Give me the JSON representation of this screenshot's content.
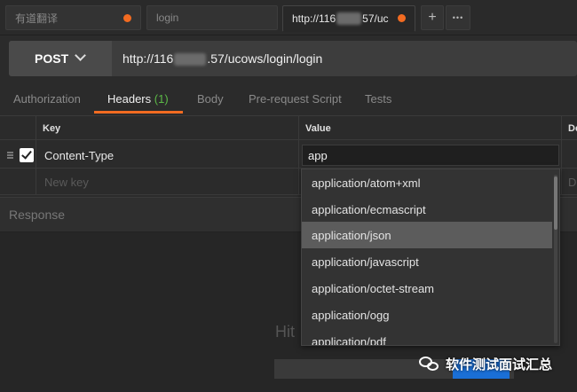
{
  "tabs": [
    {
      "label": "有道翻译",
      "modified": true
    },
    {
      "label": "login",
      "modified": false
    },
    {
      "label_prefix": "http://116",
      "label_suffix": "57/uc",
      "modified": true,
      "active": true
    }
  ],
  "tab_actions": {
    "add": "+",
    "more": "•••"
  },
  "request": {
    "method": "POST",
    "url_prefix": "http://116",
    "url_suffix": ".57/ucows/login/login"
  },
  "subtabs": [
    {
      "label": "Authorization"
    },
    {
      "label": "Headers",
      "count": "(1)",
      "active": true
    },
    {
      "label": "Body"
    },
    {
      "label": "Pre-request Script"
    },
    {
      "label": "Tests"
    }
  ],
  "headers_table": {
    "columns": {
      "key": "Key",
      "value": "Value",
      "desc": "De"
    },
    "rows": [
      {
        "key": "Content-Type",
        "value": "app",
        "enabled": true
      }
    ],
    "new_key_placeholder": "New key",
    "new_desc_placeholder": "D"
  },
  "autocomplete": [
    "application/atom+xml",
    "application/ecmascript",
    "application/json",
    "application/javascript",
    "application/octet-stream",
    "application/ogg",
    "application/pdf"
  ],
  "highlighted_option": "application/json",
  "response": {
    "label": "Response",
    "hint": "Hit"
  },
  "watermark": "软件测试面试汇总",
  "colors": {
    "accent": "#f26b21",
    "count_green": "#5cba47",
    "send_blue": "#1a6fd6"
  }
}
